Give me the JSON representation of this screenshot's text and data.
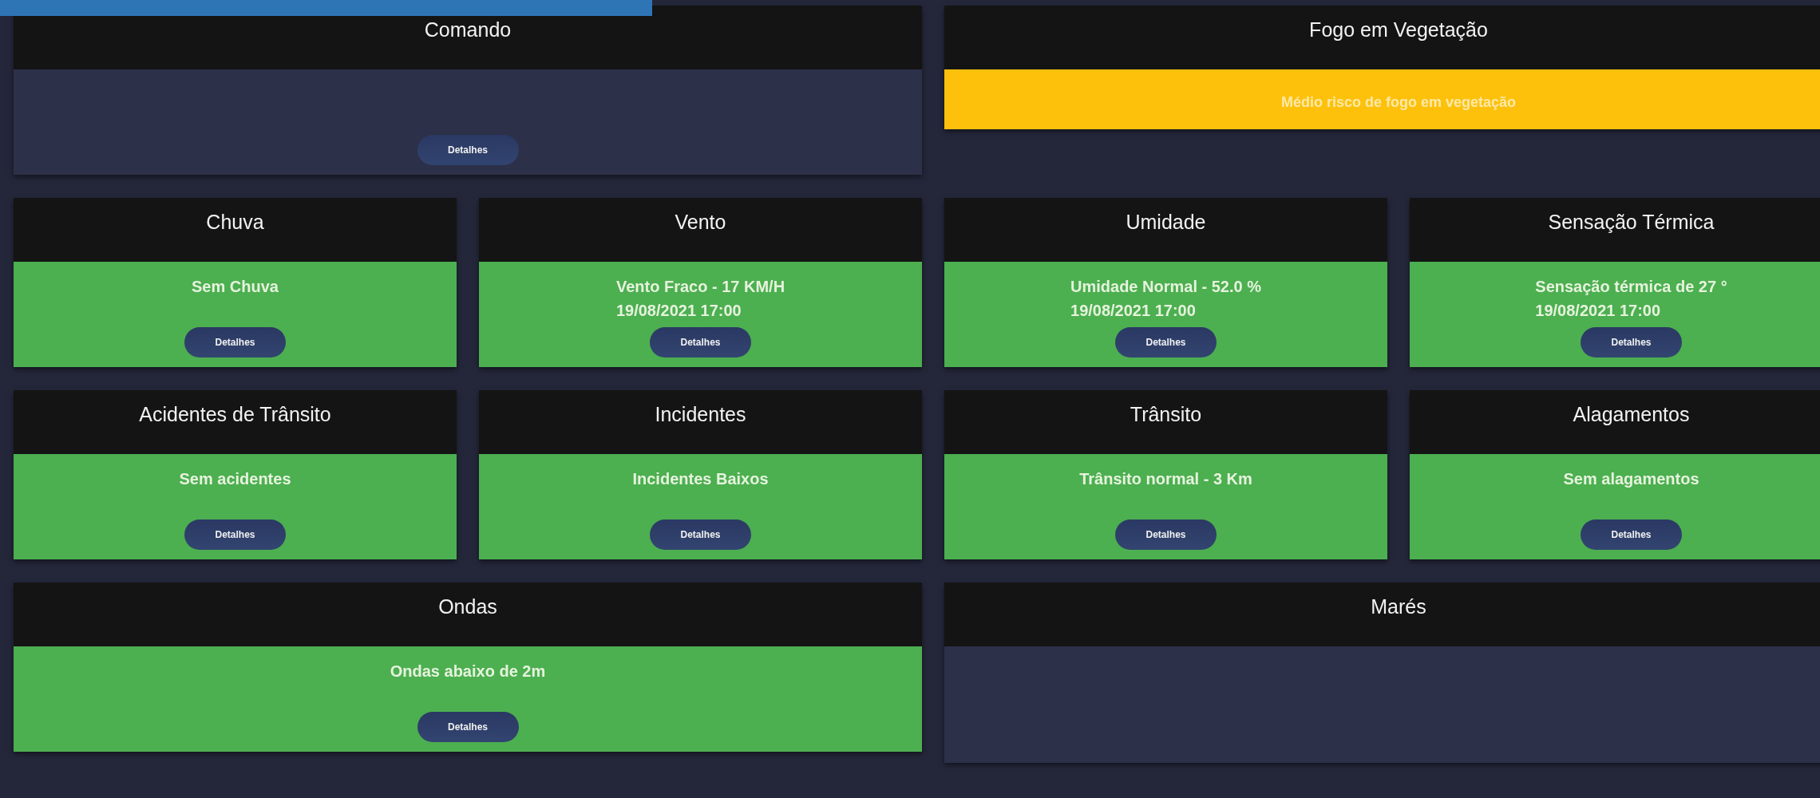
{
  "rows": [
    [
      {
        "title": "Comando",
        "button": "Detalhes"
      },
      {
        "title": "Fogo em Vegetação",
        "color": "#fdc10c",
        "lines": [
          "Médio risco de fogo em vegetação"
        ]
      }
    ],
    [
      {
        "title": "Chuva",
        "color": "#4caf50",
        "lines": [
          "Sem Chuva"
        ],
        "button": "Detalhes"
      },
      {
        "title": "Vento",
        "color": "#4caf50",
        "lines": [
          "Vento Fraco - 17 KM/H",
          "19/08/2021 17:00"
        ],
        "button": "Detalhes"
      },
      {
        "title": "Umidade",
        "color": "#4caf50",
        "lines": [
          "Umidade Normal - 52.0 %",
          "19/08/2021 17:00"
        ],
        "button": "Detalhes"
      },
      {
        "title": "Sensação Térmica",
        "color": "#4caf50",
        "lines": [
          "Sensação térmica de 27 °",
          "19/08/2021 17:00"
        ],
        "button": "Detalhes"
      }
    ],
    [
      {
        "title": "Acidentes de Trânsito",
        "color": "#4caf50",
        "lines": [
          "Sem acidentes"
        ],
        "button": "Detalhes"
      },
      {
        "title": "Incidentes",
        "color": "#4caf50",
        "lines": [
          "Incidentes Baixos"
        ],
        "button": "Detalhes"
      },
      {
        "title": "Trânsito",
        "color": "#4caf50",
        "lines": [
          "Trânsito normal - 3 Km"
        ],
        "button": "Detalhes"
      },
      {
        "title": "Alagamentos",
        "color": "#4caf50",
        "lines": [
          "Sem alagamentos"
        ],
        "button": "Detalhes"
      }
    ],
    [
      {
        "title": "Ondas",
        "color": "#4caf50",
        "lines": [
          "Ondas abaixo de 2m"
        ],
        "button": "Detalhes"
      },
      {
        "title": "Marés"
      }
    ]
  ]
}
